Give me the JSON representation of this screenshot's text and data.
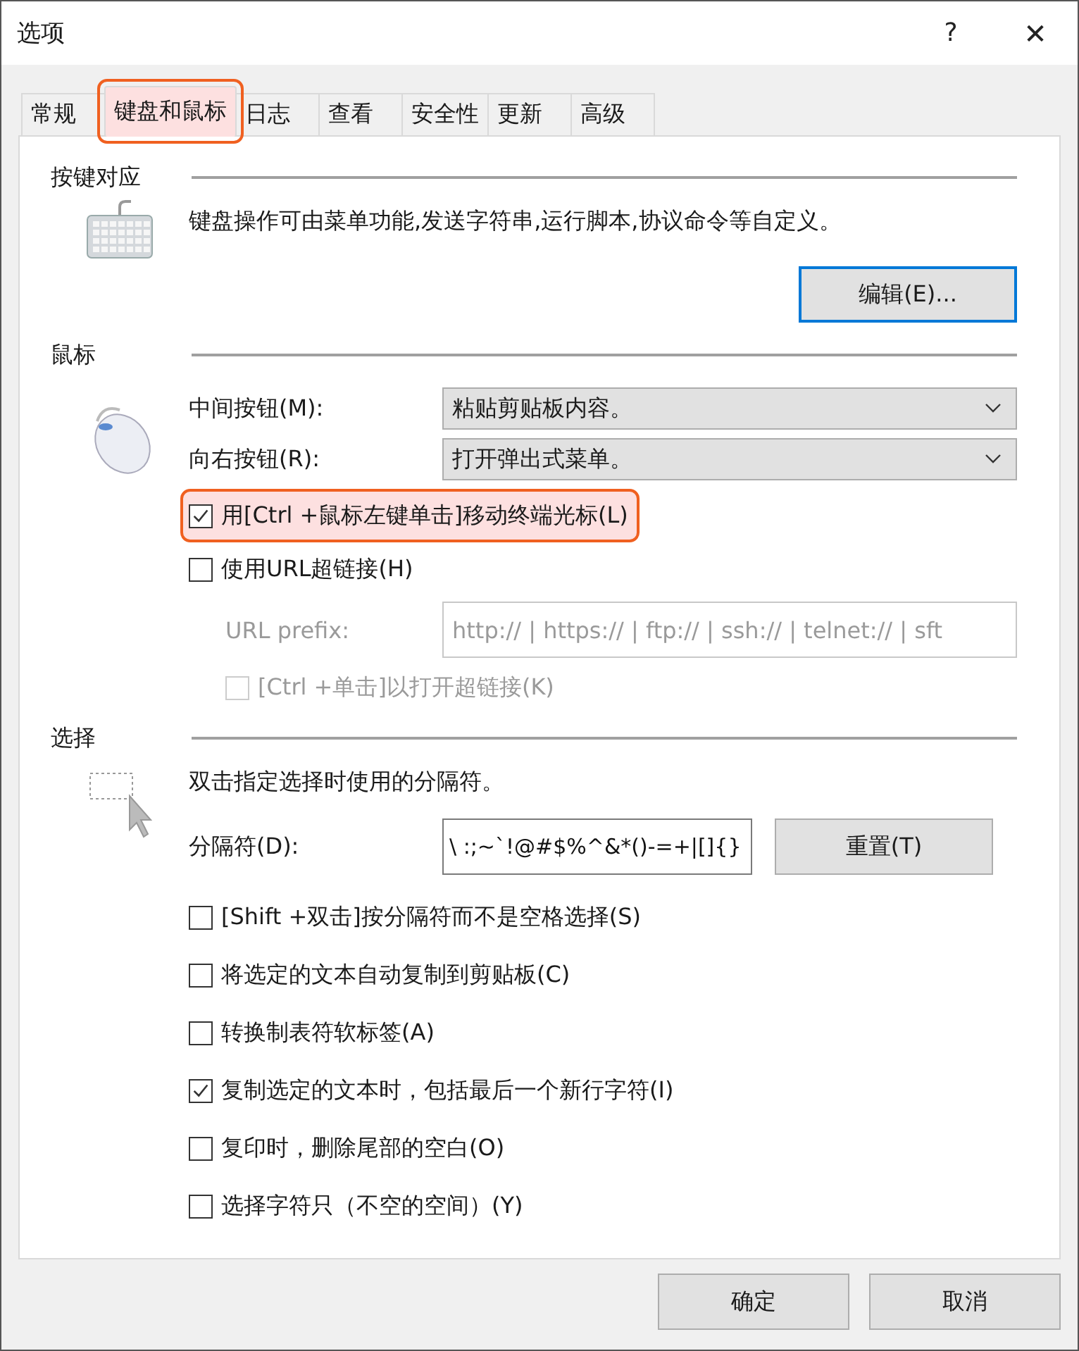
{
  "window": {
    "title": "选项",
    "help_button": "?",
    "close_button": "✕"
  },
  "tabs": [
    {
      "label": "常规",
      "selected": false,
      "highlighted": false
    },
    {
      "label": "键盘和鼠标",
      "selected": true,
      "highlighted": true
    },
    {
      "label": "日志",
      "selected": false,
      "highlighted": false
    },
    {
      "label": "查看",
      "selected": false,
      "highlighted": false
    },
    {
      "label": "安全性",
      "selected": false,
      "highlighted": false
    },
    {
      "label": "更新",
      "selected": false,
      "highlighted": false
    },
    {
      "label": "高级",
      "selected": false,
      "highlighted": false
    }
  ],
  "keymap": {
    "heading": "按键对应",
    "description": "键盘操作可由菜单功能,发送字符串,运行脚本,协议命令等自定义。",
    "edit_button": "编辑(E)..."
  },
  "mouse": {
    "heading": "鼠标",
    "dropdowns": [
      {
        "label": "中间按钮(M):",
        "value": "粘贴剪贴板内容。"
      },
      {
        "label": "向右按钮(R):",
        "value": "打开弹出式菜单。"
      }
    ],
    "ctrl_click": {
      "label": "用[Ctrl +鼠标左键单击]移动终端光标(L)",
      "checked": true,
      "highlighted": true
    },
    "url_links": {
      "label": "使用URL超链接(H)",
      "checked": false
    },
    "url_prefix": {
      "label": "URL prefix:",
      "value": "http:// | https:// | ftp:// | ssh:// | telnet:// | sft",
      "disabled": true
    },
    "ctrl_click_links": {
      "label": "[Ctrl +单击]以打开超链接(K)",
      "checked": false,
      "disabled": true
    }
  },
  "selection": {
    "heading": "选择",
    "description": "双击指定选择时使用的分隔符。",
    "delimiter_label": "分隔符(D):",
    "delimiter_value": "\\ :;~`!@#$%^&*()-=+|[]{}",
    "reset_button": "重置(T)",
    "options": [
      {
        "label": "[Shift +双击]按分隔符而不是空格选择(S)",
        "checked": false
      },
      {
        "label": "将选定的文本自动复制到剪贴板(C)",
        "checked": false
      },
      {
        "label": "转换制表符软标签(A)",
        "checked": false
      },
      {
        "label": "复制选定的文本时，包括最后一个新行字符(I)",
        "checked": true
      },
      {
        "label": "复印时，删除尾部的空白(O)",
        "checked": false
      },
      {
        "label": "选择字符只（不空的空间）(Y)",
        "checked": false
      }
    ]
  },
  "buttons": [
    "确定",
    "取消"
  ]
}
